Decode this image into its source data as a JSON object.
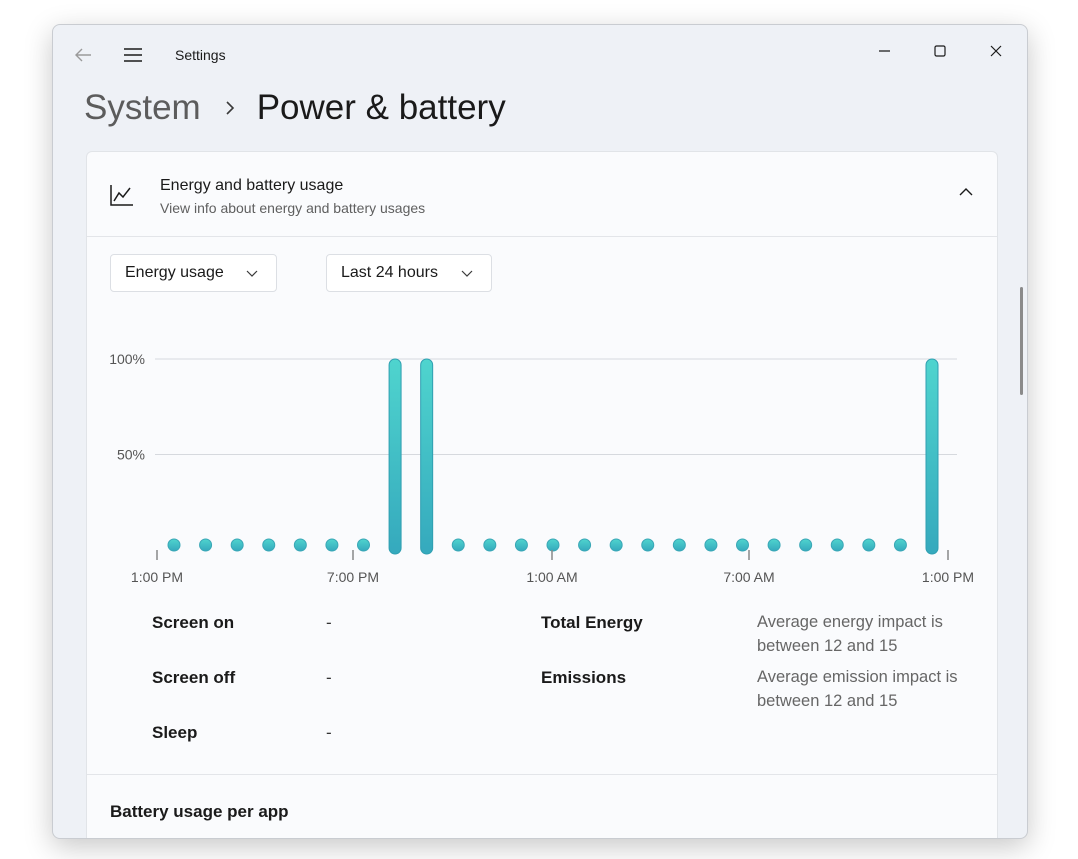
{
  "window": {
    "title": "Settings",
    "back_icon": "back-arrow-icon",
    "menu_icon": "hamburger-menu-icon",
    "controls": [
      "minimize-icon",
      "maximize-icon",
      "close-icon"
    ]
  },
  "breadcrumb": {
    "parent": "System",
    "separator_icon": "chevron-right-icon",
    "current": "Power & battery"
  },
  "card": {
    "icon": "line-chart-icon",
    "title": "Energy and battery usage",
    "subtitle": "View info about energy and battery usages",
    "collapse_icon": "chevron-up-icon",
    "dropdown_type": "Energy usage",
    "dropdown_range": "Last 24 hours"
  },
  "chart_data": {
    "type": "bar",
    "y_tick_labels": [
      "100%",
      "50%"
    ],
    "x_tick_labels": [
      "1:00 PM",
      "7:00 PM",
      "1:00 AM",
      "7:00 AM",
      "1:00 PM"
    ],
    "ylim": [
      0,
      100
    ],
    "values": [
      0,
      0,
      0,
      0,
      0,
      0,
      0,
      100,
      100,
      0,
      0,
      0,
      0,
      0,
      0,
      0,
      0,
      0,
      0,
      0,
      0,
      0,
      0,
      0,
      100
    ],
    "color_top": "#4fd4ce",
    "color_bottom": "#35a9bd",
    "grid": true
  },
  "stats": {
    "screen_on_label": "Screen on",
    "screen_on_value": "-",
    "screen_off_label": "Screen off",
    "screen_off_value": "-",
    "sleep_label": "Sleep",
    "sleep_value": "-",
    "total_energy_label": "Total Energy",
    "total_energy_desc": "Average energy impact is between 12 and 15",
    "emissions_label": "Emissions",
    "emissions_desc": "Average emission impact is between 12 and 15"
  },
  "battery_section": {
    "title": "Battery usage per app"
  }
}
